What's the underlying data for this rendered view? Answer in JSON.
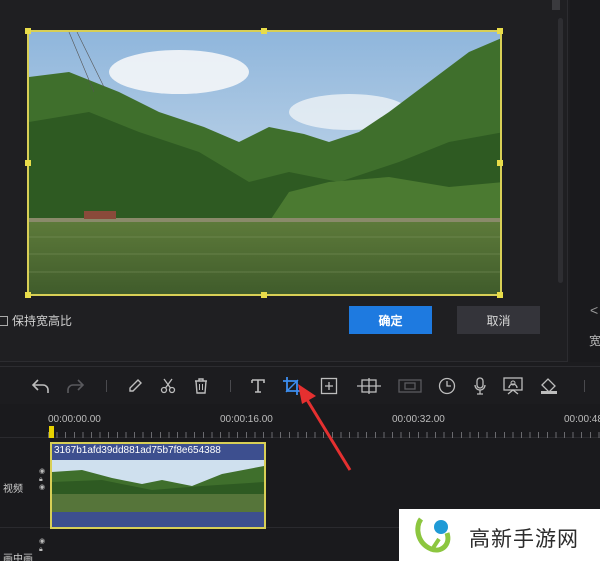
{
  "crop_dialog": {
    "keep_ratio_label": "保持宽高比",
    "confirm_label": "确定",
    "cancel_label": "取消"
  },
  "right_panel": {
    "chevron": "<",
    "label": "宽"
  },
  "toolbar": {
    "tools": [
      "undo-icon",
      "redo-icon",
      "pencil-icon",
      "scissors-icon",
      "trash-icon",
      "text-icon",
      "crop-icon",
      "zoom-frame-icon",
      "mosaic-icon",
      "freeze-frame-icon",
      "speed-clock-icon",
      "microphone-icon",
      "screen-record-icon",
      "color-fill-icon"
    ],
    "active_tool": "crop-icon",
    "accent": "#1e7ae0"
  },
  "timeline": {
    "ticks": [
      "00:00:00.00",
      "00:00:16.00",
      "00:00:32.00",
      "00:00:48"
    ],
    "tracks": [
      {
        "label": "视频"
      },
      {
        "label": "画中画"
      }
    ],
    "clip": {
      "name": "3167b1afd39dd881ad75b7f8e654388"
    }
  },
  "watermark": {
    "text": "高新手游网"
  },
  "colors": {
    "selection_border": "#d8cf56",
    "confirm_button": "#1e7ae0",
    "clip_fill": "#3d4f8f",
    "annotation_arrow": "#e53030"
  }
}
